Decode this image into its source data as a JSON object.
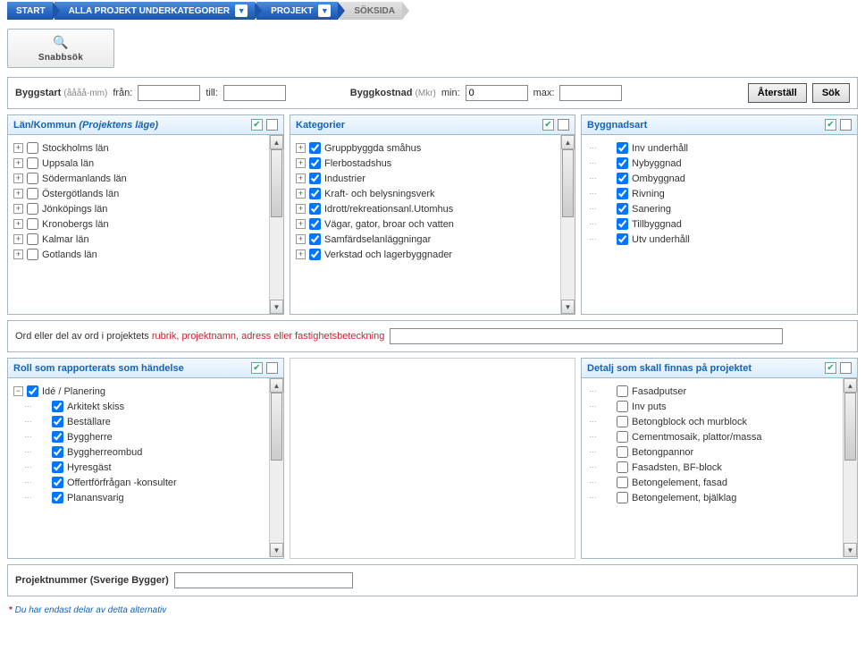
{
  "breadcrumb": {
    "items": [
      {
        "label": "START"
      },
      {
        "label": "ALLA PROJEKT UNDERKATEGORIER",
        "dropdown": true
      },
      {
        "label": "PROJEKT",
        "dropdown": true
      },
      {
        "label": "SÖKSIDA",
        "dim": true
      }
    ]
  },
  "quicksearch": {
    "label": "Snabbsök"
  },
  "searchbar": {
    "byggstart_label": "Byggstart",
    "byggstart_hint": "(åååå-mm)",
    "from_label": "från:",
    "to_label": "till:",
    "byggkostnad_label": "Byggkostnad",
    "byggkostnad_hint": "(Mkr)",
    "min_label": "min:",
    "min_value": "0",
    "max_label": "max:",
    "reset_label": "Återställ",
    "search_label": "Sök"
  },
  "panel_lan": {
    "title_a": "Län/Kommun ",
    "title_b": "(Projektens läge)",
    "items": [
      {
        "label": "Stockholms län"
      },
      {
        "label": "Uppsala län"
      },
      {
        "label": "Södermanlands län"
      },
      {
        "label": "Östergötlands län"
      },
      {
        "label": "Jönköpings län"
      },
      {
        "label": "Kronobergs län"
      },
      {
        "label": "Kalmar län"
      },
      {
        "label": "Gotlands län"
      }
    ]
  },
  "panel_kat": {
    "title": "Kategorier",
    "items": [
      {
        "label": "Gruppbyggda småhus"
      },
      {
        "label": "Flerbostadshus"
      },
      {
        "label": "Industrier"
      },
      {
        "label": "Kraft- och belysningsverk"
      },
      {
        "label": "Idrott/rekreationsanl.Utomhus"
      },
      {
        "label": "Vägar, gator, broar och vatten"
      },
      {
        "label": "Samfärdselanläggningar"
      },
      {
        "label": "Verkstad och lagerbyggnader"
      }
    ]
  },
  "panel_bygg": {
    "title": "Byggnadsart",
    "items": [
      {
        "label": "Inv underhåll"
      },
      {
        "label": "Nybyggnad"
      },
      {
        "label": "Ombyggnad"
      },
      {
        "label": "Rivning"
      },
      {
        "label": "Sanering"
      },
      {
        "label": "Tillbyggnad"
      },
      {
        "label": "Utv underhåll"
      }
    ]
  },
  "textsearch": {
    "prefix": "Ord eller del av ord i projektets ",
    "highlight": "rubrik, projektnamn, adress eller fastighetsbeteckning"
  },
  "panel_roll": {
    "title": "Roll som rapporterats som händelse",
    "parent": "Idé / Planering",
    "items": [
      {
        "label": "Arkitekt skiss"
      },
      {
        "label": "Beställare"
      },
      {
        "label": "Byggherre"
      },
      {
        "label": "Byggherreombud"
      },
      {
        "label": "Hyresgäst"
      },
      {
        "label": "Offertförfrågan -konsulter"
      },
      {
        "label": "Planansvarig"
      }
    ]
  },
  "panel_detalj": {
    "title": "Detalj som skall finnas på projektet",
    "items": [
      {
        "label": "Fasadputser"
      },
      {
        "label": "Inv puts"
      },
      {
        "label": "Betongblock och murblock"
      },
      {
        "label": "Cementmosaik, plattor/massa"
      },
      {
        "label": "Betongpannor"
      },
      {
        "label": "Fasadsten, BF-block"
      },
      {
        "label": "Betongelement, fasad"
      },
      {
        "label": "Betongelement, bjälklag"
      }
    ]
  },
  "projnum": {
    "label": "Projektnummer (Sverige Bygger)"
  },
  "footnote": {
    "star": "*",
    "text": " Du har endast delar av detta alternativ"
  }
}
